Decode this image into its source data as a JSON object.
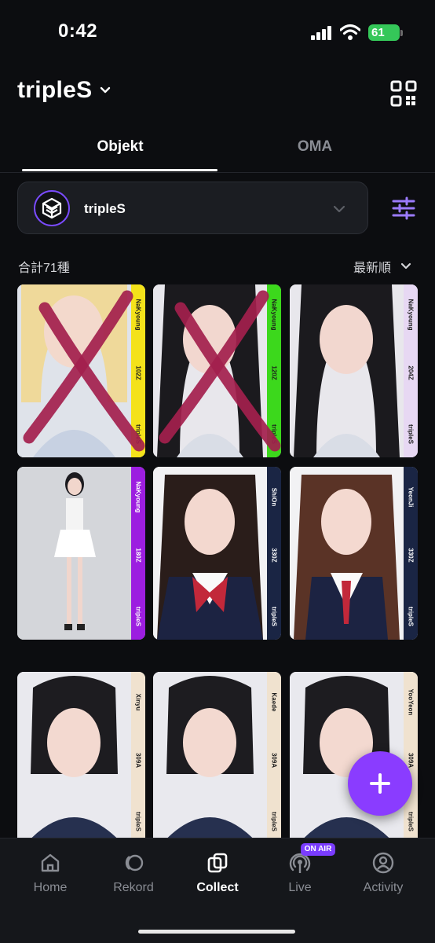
{
  "status_bar": {
    "time": "0:42",
    "battery": "61"
  },
  "header": {
    "title": "tripleS"
  },
  "tabs": [
    {
      "label": "Objekt",
      "active": true
    },
    {
      "label": "OMA",
      "active": false
    }
  ],
  "filter": {
    "artist": "tripleS"
  },
  "collection": {
    "count_label": "合計71種",
    "sort_label": "最新順"
  },
  "cards": [
    {
      "member": "NaKyoung",
      "number": "102Z",
      "group": "tripleS",
      "band_color": "#f4e21a",
      "photo": "blonde",
      "crossed": true
    },
    {
      "member": "NaKyoung",
      "number": "120Z",
      "group": "tripleS",
      "band_color": "#3cd81c",
      "photo": "black-hair",
      "crossed": true
    },
    {
      "member": "NaKyoung",
      "number": "204Z",
      "group": "tripleS",
      "band_color": "#e7d8f3",
      "photo": "black-hair",
      "crossed": false
    },
    {
      "member": "NaKyoung",
      "number": "180Z",
      "group": "tripleS",
      "band_color": "#9c1ee0",
      "photo": "full-body",
      "crossed": false
    },
    {
      "member": "ShiOn",
      "number": "330Z",
      "group": "tripleS",
      "band_color": "#1a2544",
      "photo": "uniform",
      "crossed": false
    },
    {
      "member": "YeonJi",
      "number": "330Z",
      "group": "tripleS",
      "band_color": "#1a2544",
      "photo": "uniform-brown",
      "crossed": false
    },
    {
      "member": "Xinyu",
      "number": "309A",
      "group": "tripleS",
      "band_color": "#f0e2cf",
      "photo": "short-hair",
      "crossed": false
    },
    {
      "member": "Kaede",
      "number": "309A",
      "group": "tripleS",
      "band_color": "#f0e2cf",
      "photo": "short-hair",
      "crossed": false
    },
    {
      "member": "YooYeon",
      "number": "309A",
      "group": "tripleS",
      "band_color": "#f0e2cf",
      "photo": "short-hair",
      "crossed": false
    }
  ],
  "nav": [
    {
      "label": "Home",
      "icon": "home-icon",
      "active": false
    },
    {
      "label": "Rekord",
      "icon": "rekord-icon",
      "active": false
    },
    {
      "label": "Collect",
      "icon": "collect-icon",
      "active": true
    },
    {
      "label": "Live",
      "icon": "live-icon",
      "active": false,
      "badge": "ON AIR"
    },
    {
      "label": "Activity",
      "icon": "activity-icon",
      "active": false
    }
  ],
  "colors": {
    "accent": "#8a3cff",
    "background": "#0c0d10"
  }
}
